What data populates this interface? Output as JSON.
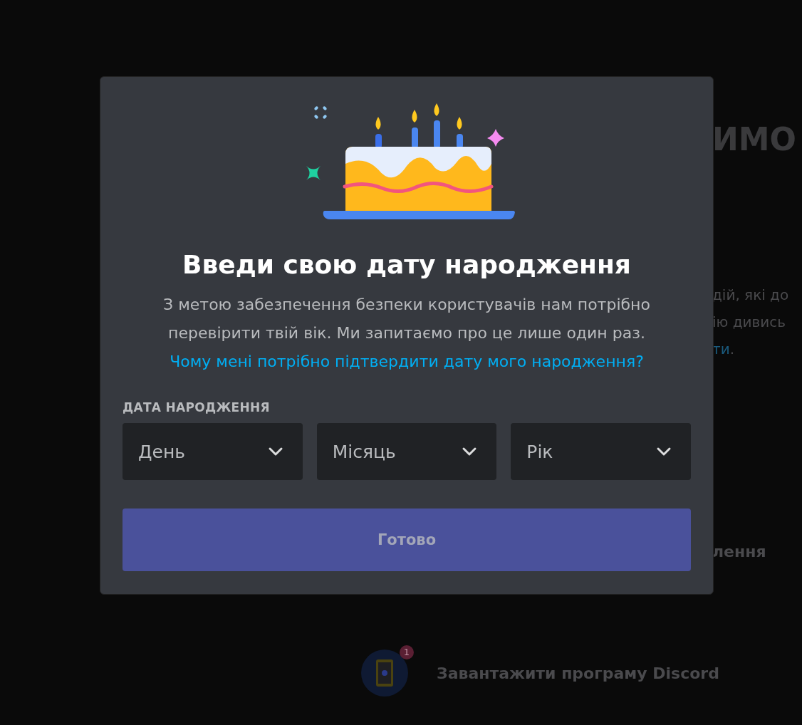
{
  "background": {
    "heading": "ИМО",
    "lines": [
      {
        "kind": "plain",
        "text": "дій, які до"
      },
      {
        "kind": "plain",
        "text": "ію дивись"
      },
      {
        "kind": "link",
        "text": "ти",
        "tail": "."
      }
    ],
    "section_label": "лення",
    "download": {
      "label": "Завантажити програму Discord",
      "badge": "1"
    }
  },
  "modal": {
    "title": "Введи свою дату народження",
    "description": "З метою забезпечення безпеки користувачів нам потрібно перевірити твій вік. Ми запитаємо про це лише один раз.",
    "link": "Чому мені потрібно підтвердити дату мого народження?",
    "field_label": "ДАТА НАРОДЖЕННЯ",
    "dropdowns": [
      {
        "placeholder": "День"
      },
      {
        "placeholder": "Місяць"
      },
      {
        "placeholder": "Рік"
      }
    ],
    "button": {
      "label": "Готово",
      "disabled": true
    }
  }
}
